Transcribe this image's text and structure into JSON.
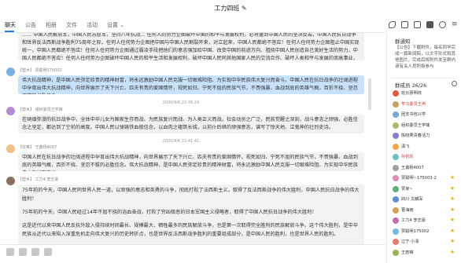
{
  "window": {
    "title": "工力四班 ✎"
  },
  "tabs": [
    "聊天",
    "公告",
    "相册",
    "文件",
    "活动",
    "设置 ⌄"
  ],
  "messages": [
    {
      "text": "…… 中国人民解放军，中国人民志愿军，坚持八年抗战… 任何人的势力企图破坏中国的和平与发展权利，必将遭到中国人民的坚决反击。中国人民抗日战争和世界反法西斯战争胜利75周年之际，任何人任何势力企图把中国与中国人民割裂开来，对立起来，中国人民都绝不答应！任何人任何势力企图阻止中国实现统一，中国人民都绝不答应！任何人任何势力企图通过霸凌手段把他们的意志强加给中国、改变中国的前进方向、阻挠中国人民创造自己美好生活的努力，中国人民都绝不答应！任何人任何势力企图破坏中国人民的和平生活和发展权利，破坏中国人民同其他国家人民的交流合作、破坏人类和平与发展的崇高事业，中国人民都绝不答应！",
      "highlight": false
    },
    {
      "sender": "【塑木】 贾聪明175002",
      "text": "伟大抗战精神，是中国人民弥足珍贵的精神财富，将永远激励中国人民克服一切艰难险阻、为实现中华民族伟大复兴而奋斗。中国人民在抗日战争的壮阔进程中孕育出伟大抗战精神，向世界展示了天下兴亡、匹夫有责的爱国情怀，视死如归、宁死不屈的民族气节，不畏强暴、血战到底的英雄气概，百折不挠、坚忍不拔的必胜信念。",
      "highlight": true
    },
    {
      "sender": "【塑木】 组织委员王学锋",
      "timestamp": "2020/9/6 22:36:24",
      "text": "在硝烟弥漫的抗日战争中，全体中华儿女为国家生存而战、为民族复兴而战、为人类正义而战，社会动员之广泛，民族觉醒之深刻，战斗意志之顽强，必胜信念之坚定，都达到了空前的高度。中国人民以弹铸铁血般信念，以血肉之躯筑长城，以前仆后继的顽强意志，谱写了惊天地、泣鬼神的壮烈史诗。",
      "highlight": false
    },
    {
      "sender": "【仗椎】 王鑫杨4007",
      "timestamp": "2020/9/6 22:41:41",
      "text": "中国人民在抗日战争的壮阔进程中孕育出伟大抗战精神，向世界展示了天下兴亡、匹夫有责的爱国情怀，视死如归、宁死不屈的民族气节，不畏强暴、血战到底的英雄气概，百折不挠、坚忍不拔的必胜信念。伟大抗战精神，是中国人民弥足珍贵的精神财富，将永远激励中国人民克服一切艰难险阻、为实现中华民族伟大复兴而奋斗。",
      "highlight": false
    },
    {
      "sender": "【塑木】 工力4 李志豪",
      "paragraphs": [
        "75年前的今天，中国人民同世界人民一道，以顽强的意志和英勇的斗争，彻底打败了法西斯主义，取得了反法西斯战争的伟大胜利，中国人民抗日战争的伟大胜利！",
        "75年前的今天，中国人民经过14年不屈不挠的浴血奋战，打败了穷凶极恶的日本军国主义侵略者，取得了中国人民抗日战争的伟大胜利！",
        "这是近代以来中国人民反抗外敌入侵持续时间最长、规模最大、牺牲最多的民族解放斗争，也是第一次取得完全胜利的民族解放斗争。这个伟大胜利，是中华民族从近代以来陷入深重危机走向伟大复兴的历史转折点，也是世界反法西斯战争胜利的重要组成部分，是中国人民的胜利，也是世界人民的胜利。"
      ],
      "highlight": false
    }
  ],
  "sidebar": {
    "group_notice_title": "群通知",
    "group_notice_text": "【公告】下载附件，每名同学完成一篇新闻稿，以文字形式和其他图片，完成后将附件发至群内 请有关人员积极参与",
    "member_count_label": "群成员 26/26",
    "members": [
      {
        "name": "班长廖明祥",
        "color": "#e25b45",
        "name_color": "#333"
      },
      {
        "name": "学习委员王冉",
        "color": "#c9a06a",
        "name_color": "#d23b3b"
      },
      {
        "name": "团支书包兴学",
        "color": "#7aa7d6",
        "name_color": "#333"
      },
      {
        "name": "组织委员王学锋",
        "color": "#a7b86a",
        "name_color": "#333"
      },
      {
        "name": "陈晓果青春活力",
        "color": "#8a7bd1",
        "name_color": "#333"
      },
      {
        "name": "潇飞",
        "color": "#f0a44b",
        "name_color": "#333"
      },
      {
        "name": "孙帆凯",
        "color": "#6fc0c4",
        "name_color": "#d23b3b"
      },
      {
        "name": "王鑫杨4007",
        "color": "#a0a0a0",
        "name_color": "#333"
      },
      {
        "name": "贾聪明~175003-2",
        "color": "#e08bb2",
        "name_color": "#333"
      },
      {
        "name": "贾家~",
        "color": "#5fae7a",
        "name_color": "#333"
      },
      {
        "name": "四川 文麟军",
        "color": "#5f8fd6",
        "name_color": "#333"
      },
      {
        "name": "曹海雨",
        "color": "#d4a05a",
        "name_color": "#333"
      },
      {
        "name": "工力4 李志豪",
        "color": "#c06fa8",
        "name_color": "#333"
      },
      {
        "name": "贾聪明175002",
        "color": "#77b7e0",
        "name_color": "#333"
      },
      {
        "name": "辽宁·小凛",
        "color": "#e07f6b",
        "name_color": "#333"
      },
      {
        "name": "王若琳",
        "color": "#9ab35e",
        "name_color": "#333"
      }
    ]
  }
}
